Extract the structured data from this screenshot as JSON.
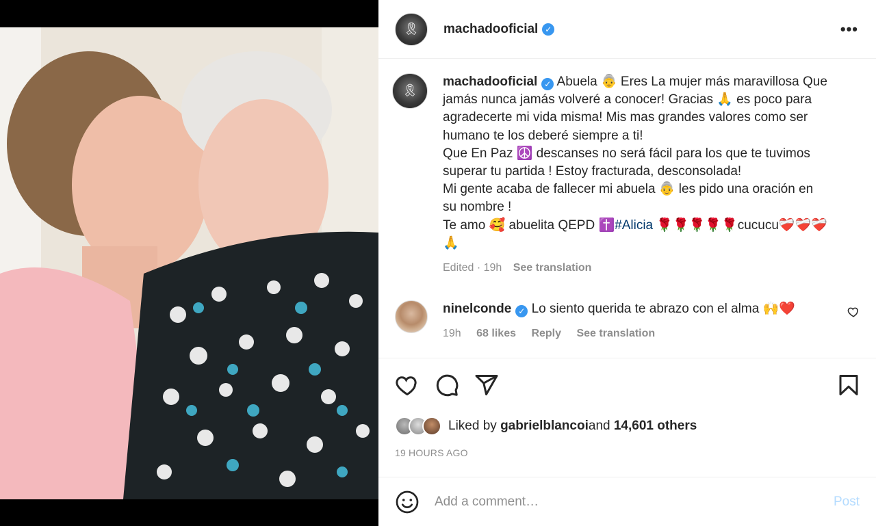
{
  "post": {
    "username": "machadooficial",
    "verified_mark": "✓",
    "more_icon": "•••",
    "avatar_glyph": "🎗"
  },
  "caption": {
    "username": "machadooficial",
    "lines": [
      " Abuela 👵 Eres La mujer más maravillosa Que",
      "jamás nunca jamás volveré a conocer! Gracias 🙏 es poco para",
      "agradecerte mi vida misma! Mis mas grandes valores como ser",
      "humano te los deberé siempre a ti!",
      "Que En Paz ☮️ descanses no será fácil para los que te tuvimos",
      "superar tu partida ! Estoy fracturada, desconsolada!",
      "Mi gente acaba de fallecer mi abuela 👵 les pido una oración en",
      "su nombre !"
    ],
    "last_line_prefix": "Te amo 🥰 abuelita QEPD ✝️",
    "hashtag": "#Alicia",
    "last_line_suffix": " 🌹🌹🌹🌹🌹cucucu❤️‍🩹❤️‍🩹❤️‍🩹",
    "final_line": "🙏",
    "edited": "Edited · 19h",
    "see_translation": "See translation"
  },
  "comment": {
    "username": "ninelconde",
    "text": " Lo siento querida te abrazo con el alma 🙌❤️",
    "time": "19h",
    "likes": "68 likes",
    "reply": "Reply",
    "see_translation": "See translation"
  },
  "likes": {
    "prefix": "Liked by ",
    "user": "gabrielblancoi",
    "middle": " and ",
    "others": "14,601 others"
  },
  "timestamp": "19 HOURS AGO",
  "add_comment": {
    "placeholder": "Add a comment…",
    "post_label": "Post"
  },
  "colors": {
    "verified": "#3897f0",
    "hashtag": "#00376b",
    "post_button": "#b3dbff"
  },
  "icons": [
    "heart-icon",
    "comment-icon",
    "share-icon",
    "bookmark-icon",
    "emoji-icon",
    "more-icon",
    "verified-icon"
  ]
}
